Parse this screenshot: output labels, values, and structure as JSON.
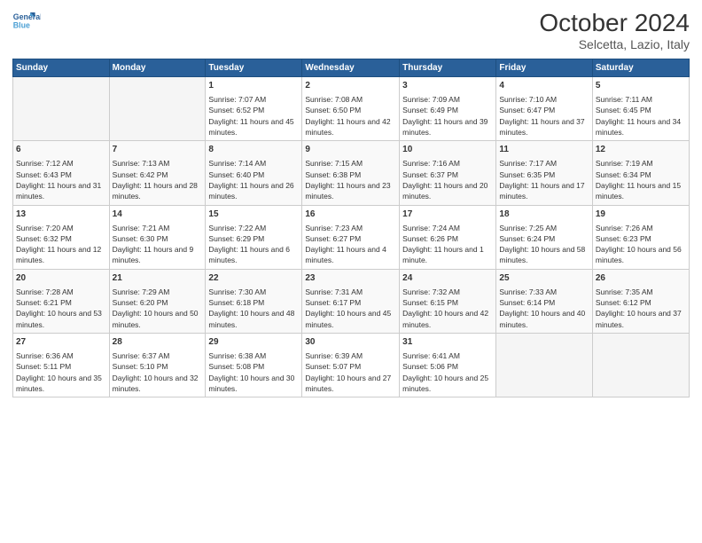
{
  "header": {
    "logo_line1": "General",
    "logo_line2": "Blue",
    "month": "October 2024",
    "location": "Selcetta, Lazio, Italy"
  },
  "weekdays": [
    "Sunday",
    "Monday",
    "Tuesday",
    "Wednesday",
    "Thursday",
    "Friday",
    "Saturday"
  ],
  "weeks": [
    [
      {
        "day": "",
        "info": ""
      },
      {
        "day": "",
        "info": ""
      },
      {
        "day": "1",
        "info": "Sunrise: 7:07 AM\nSunset: 6:52 PM\nDaylight: 11 hours and 45 minutes."
      },
      {
        "day": "2",
        "info": "Sunrise: 7:08 AM\nSunset: 6:50 PM\nDaylight: 11 hours and 42 minutes."
      },
      {
        "day": "3",
        "info": "Sunrise: 7:09 AM\nSunset: 6:49 PM\nDaylight: 11 hours and 39 minutes."
      },
      {
        "day": "4",
        "info": "Sunrise: 7:10 AM\nSunset: 6:47 PM\nDaylight: 11 hours and 37 minutes."
      },
      {
        "day": "5",
        "info": "Sunrise: 7:11 AM\nSunset: 6:45 PM\nDaylight: 11 hours and 34 minutes."
      }
    ],
    [
      {
        "day": "6",
        "info": "Sunrise: 7:12 AM\nSunset: 6:43 PM\nDaylight: 11 hours and 31 minutes."
      },
      {
        "day": "7",
        "info": "Sunrise: 7:13 AM\nSunset: 6:42 PM\nDaylight: 11 hours and 28 minutes."
      },
      {
        "day": "8",
        "info": "Sunrise: 7:14 AM\nSunset: 6:40 PM\nDaylight: 11 hours and 26 minutes."
      },
      {
        "day": "9",
        "info": "Sunrise: 7:15 AM\nSunset: 6:38 PM\nDaylight: 11 hours and 23 minutes."
      },
      {
        "day": "10",
        "info": "Sunrise: 7:16 AM\nSunset: 6:37 PM\nDaylight: 11 hours and 20 minutes."
      },
      {
        "day": "11",
        "info": "Sunrise: 7:17 AM\nSunset: 6:35 PM\nDaylight: 11 hours and 17 minutes."
      },
      {
        "day": "12",
        "info": "Sunrise: 7:19 AM\nSunset: 6:34 PM\nDaylight: 11 hours and 15 minutes."
      }
    ],
    [
      {
        "day": "13",
        "info": "Sunrise: 7:20 AM\nSunset: 6:32 PM\nDaylight: 11 hours and 12 minutes."
      },
      {
        "day": "14",
        "info": "Sunrise: 7:21 AM\nSunset: 6:30 PM\nDaylight: 11 hours and 9 minutes."
      },
      {
        "day": "15",
        "info": "Sunrise: 7:22 AM\nSunset: 6:29 PM\nDaylight: 11 hours and 6 minutes."
      },
      {
        "day": "16",
        "info": "Sunrise: 7:23 AM\nSunset: 6:27 PM\nDaylight: 11 hours and 4 minutes."
      },
      {
        "day": "17",
        "info": "Sunrise: 7:24 AM\nSunset: 6:26 PM\nDaylight: 11 hours and 1 minute."
      },
      {
        "day": "18",
        "info": "Sunrise: 7:25 AM\nSunset: 6:24 PM\nDaylight: 10 hours and 58 minutes."
      },
      {
        "day": "19",
        "info": "Sunrise: 7:26 AM\nSunset: 6:23 PM\nDaylight: 10 hours and 56 minutes."
      }
    ],
    [
      {
        "day": "20",
        "info": "Sunrise: 7:28 AM\nSunset: 6:21 PM\nDaylight: 10 hours and 53 minutes."
      },
      {
        "day": "21",
        "info": "Sunrise: 7:29 AM\nSunset: 6:20 PM\nDaylight: 10 hours and 50 minutes."
      },
      {
        "day": "22",
        "info": "Sunrise: 7:30 AM\nSunset: 6:18 PM\nDaylight: 10 hours and 48 minutes."
      },
      {
        "day": "23",
        "info": "Sunrise: 7:31 AM\nSunset: 6:17 PM\nDaylight: 10 hours and 45 minutes."
      },
      {
        "day": "24",
        "info": "Sunrise: 7:32 AM\nSunset: 6:15 PM\nDaylight: 10 hours and 42 minutes."
      },
      {
        "day": "25",
        "info": "Sunrise: 7:33 AM\nSunset: 6:14 PM\nDaylight: 10 hours and 40 minutes."
      },
      {
        "day": "26",
        "info": "Sunrise: 7:35 AM\nSunset: 6:12 PM\nDaylight: 10 hours and 37 minutes."
      }
    ],
    [
      {
        "day": "27",
        "info": "Sunrise: 6:36 AM\nSunset: 5:11 PM\nDaylight: 10 hours and 35 minutes."
      },
      {
        "day": "28",
        "info": "Sunrise: 6:37 AM\nSunset: 5:10 PM\nDaylight: 10 hours and 32 minutes."
      },
      {
        "day": "29",
        "info": "Sunrise: 6:38 AM\nSunset: 5:08 PM\nDaylight: 10 hours and 30 minutes."
      },
      {
        "day": "30",
        "info": "Sunrise: 6:39 AM\nSunset: 5:07 PM\nDaylight: 10 hours and 27 minutes."
      },
      {
        "day": "31",
        "info": "Sunrise: 6:41 AM\nSunset: 5:06 PM\nDaylight: 10 hours and 25 minutes."
      },
      {
        "day": "",
        "info": ""
      },
      {
        "day": "",
        "info": ""
      }
    ]
  ]
}
